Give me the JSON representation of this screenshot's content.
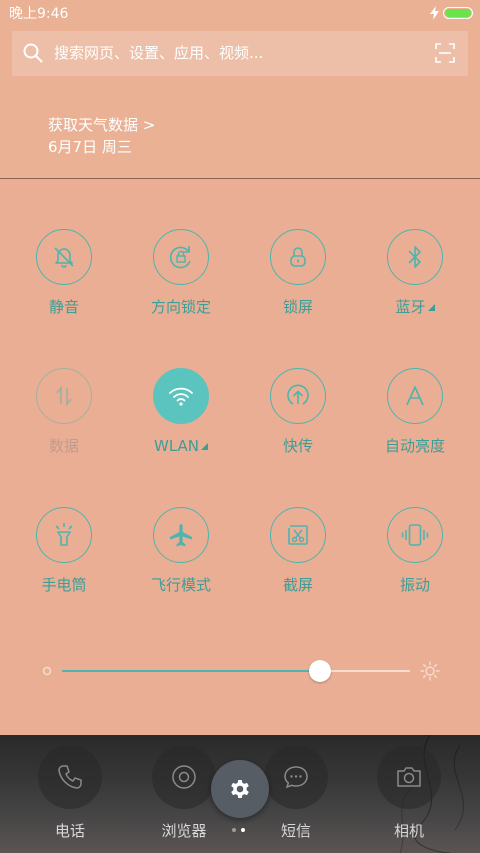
{
  "status_bar": {
    "time": "晚上9:46",
    "battery_level": 1.0,
    "battery_color": "#6be34a",
    "charging_icon": "lightning-icon"
  },
  "search": {
    "placeholder": "搜索网页、设置、应用、视频...",
    "search_icon": "search-icon",
    "scan_icon": "scan-icon"
  },
  "weather": {
    "link": "获取天气数据 >",
    "date": "6月7日 周三"
  },
  "colors": {
    "background": "#e9ae94",
    "accent": "#4fb4ae",
    "active_toggle": "#5bc4be"
  },
  "toggles": [
    {
      "label": "静音",
      "icon": "bell-off-icon",
      "state": "off"
    },
    {
      "label": "方向锁定",
      "icon": "rotation-lock-icon",
      "state": "off"
    },
    {
      "label": "锁屏",
      "icon": "lock-icon",
      "state": "off"
    },
    {
      "label": "蓝牙",
      "icon": "bluetooth-icon",
      "state": "off",
      "has_more": true
    },
    {
      "label": "数据",
      "icon": "mobile-data-icon",
      "state": "disabled"
    },
    {
      "label": "WLAN",
      "icon": "wifi-icon",
      "state": "on",
      "has_more": true
    },
    {
      "label": "快传",
      "icon": "quick-share-icon",
      "state": "off"
    },
    {
      "label": "自动亮度",
      "icon": "auto-brightness-icon",
      "state": "off"
    },
    {
      "label": "手电筒",
      "icon": "flashlight-icon",
      "state": "off"
    },
    {
      "label": "飞行模式",
      "icon": "airplane-icon",
      "state": "off"
    },
    {
      "label": "截屏",
      "icon": "screenshot-icon",
      "state": "off"
    },
    {
      "label": "振动",
      "icon": "vibrate-icon",
      "state": "off"
    }
  ],
  "brightness": {
    "level": 0.74,
    "low_icon": "brightness-low-icon",
    "high_icon": "brightness-high-icon"
  },
  "dock": {
    "apps": [
      {
        "label": "电话",
        "icon": "phone-icon"
      },
      {
        "label": "浏览器",
        "icon": "browser-icon"
      },
      {
        "label": "短信",
        "icon": "message-icon"
      },
      {
        "label": "相机",
        "icon": "camera-icon"
      }
    ],
    "pages": 2,
    "current_page": 2
  },
  "settings_button": {
    "icon": "gear-icon"
  }
}
